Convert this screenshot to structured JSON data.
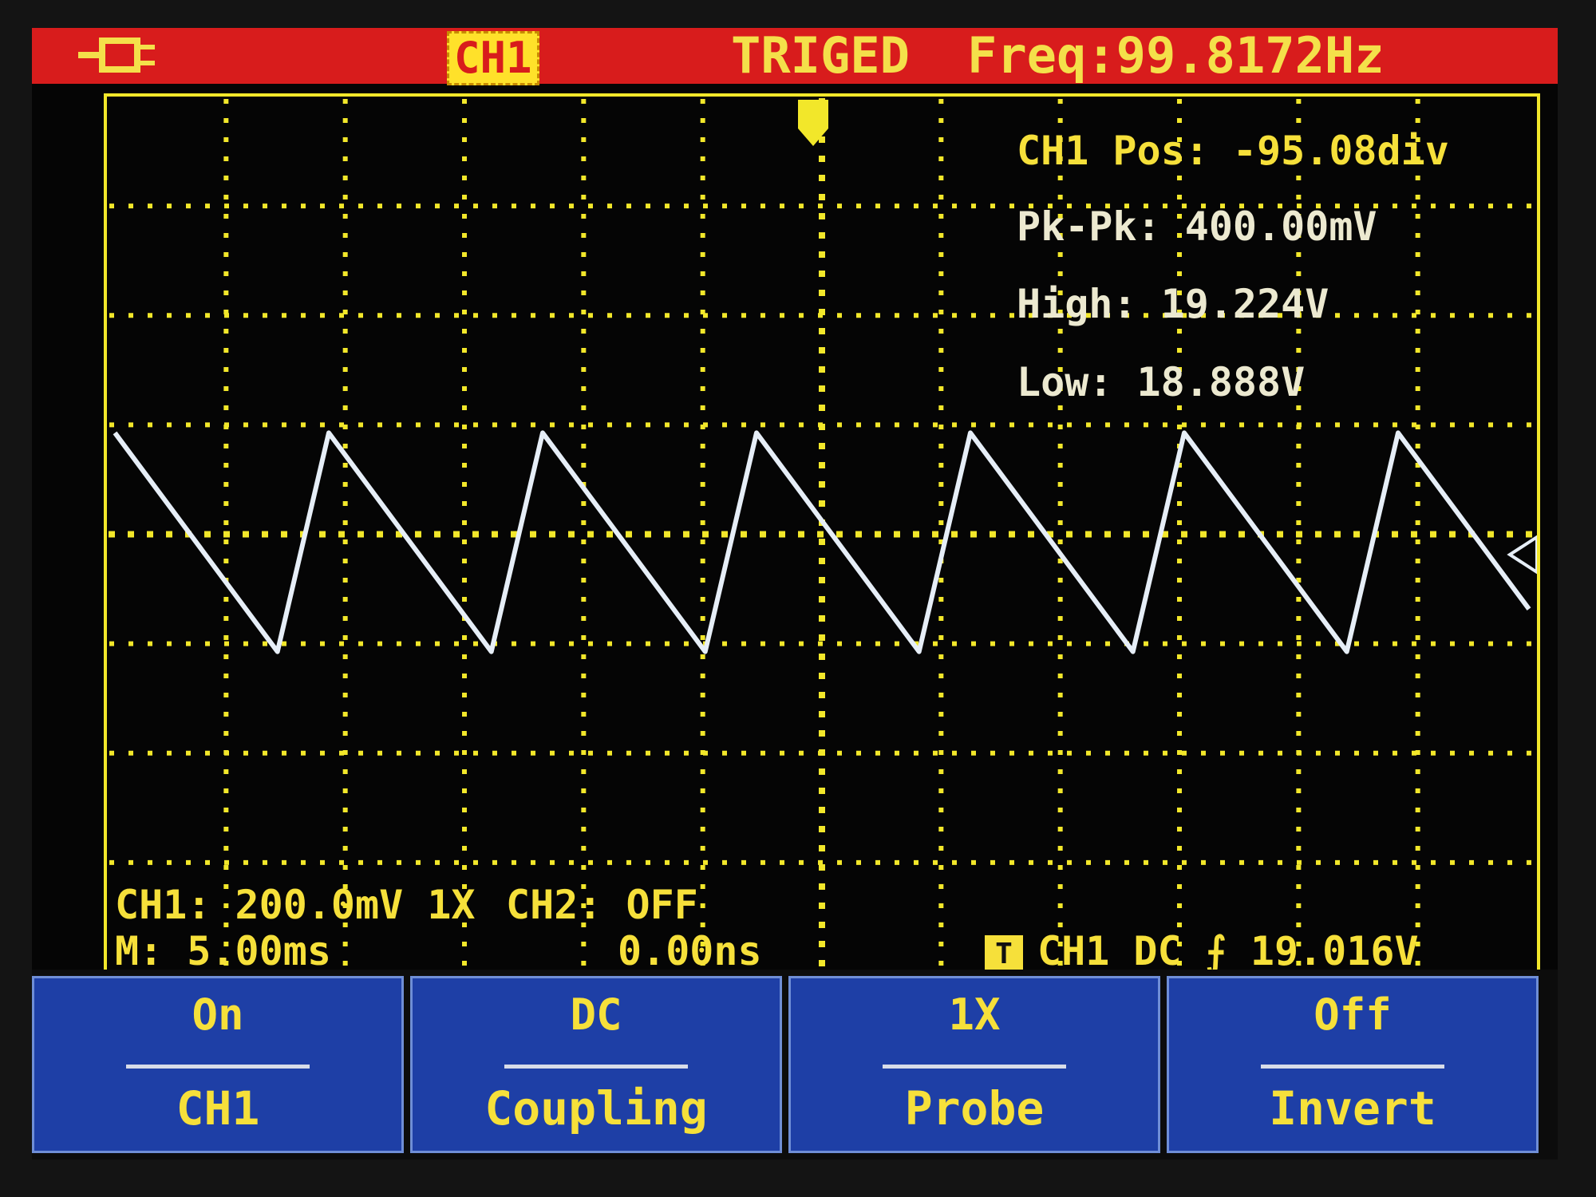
{
  "status_bar": {
    "channel_tag": "CH1",
    "trigger_state": "TRIGED",
    "frequency": "Freq:99.8172Hz"
  },
  "measurements": {
    "position": "CH1 Pos: -95.08div",
    "pk_pk": "Pk-Pk: 400.00mV",
    "high": "High: 19.224V",
    "low": "Low: 18.888V"
  },
  "bottom_info": {
    "ch1_scale": "CH1: 200.0mV 1X",
    "ch2_state": "CH2: OFF",
    "timebase": "M: 5.00ms",
    "trigger_time": "0.00ns",
    "trigger_badge": "T",
    "trigger_info": "CH1 DC ⨍ 19.016V"
  },
  "softkeys": [
    {
      "value": "On",
      "label": "CH1"
    },
    {
      "value": "DC",
      "label": "Coupling"
    },
    {
      "value": "1X",
      "label": "Probe"
    },
    {
      "value": "Off",
      "label": "Invert"
    }
  ],
  "colors": {
    "status_bar": "#d81c1c",
    "grid": "#f2e72a",
    "trace": "#e6eef7",
    "softkey_bg": "#1e3fa6"
  },
  "icons": {
    "probe": "probe-connector-icon",
    "trigger_marker": "trigger-position-icon",
    "level_marker": "trigger-level-arrow-icon"
  }
}
